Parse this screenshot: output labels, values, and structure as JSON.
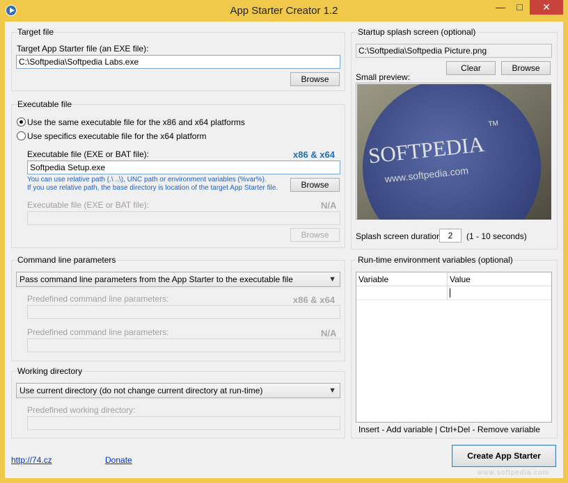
{
  "window": {
    "title": "App Starter Creator 1.2",
    "min_icon": "minimize-icon",
    "max_icon": "maximize-icon",
    "close_icon": "close-icon"
  },
  "target": {
    "group": "Target file",
    "label": "Target App Starter file (an EXE file):",
    "value": "C:\\Softpedia\\Softpedia Labs.exe",
    "browse": "Browse"
  },
  "executable": {
    "group": "Executable file",
    "radio_same": "Use the same executable file for the x86 and x64 platforms",
    "radio_specific": "Use specifics executable file for the x64 platform",
    "exe_label": "Executable file (EXE or BAT file):",
    "exe_tag": "x86 & x64",
    "exe_value": "Softpedia Setup.exe",
    "hint1": "You can use relative path (.\\ ..\\), UNC path or environment variables (%var%).",
    "hint2": "If you use relative path, the base directory is location of the target App Starter file.",
    "browse": "Browse",
    "exe2_label": "Executable file (EXE or BAT file):",
    "exe2_tag": "N/A",
    "browse2": "Browse"
  },
  "cmdline": {
    "group": "Command line parameters",
    "selected": "Pass command line parameters from the App Starter to the executable file",
    "param1_label": "Predefined command line parameters:",
    "param1_tag": "x86 & x64",
    "param2_label": "Predefined command line parameters:",
    "param2_tag": "N/A"
  },
  "workdir": {
    "group": "Working directory",
    "selected": "Use current directory (do not change current directory at run-time)",
    "predef_label": "Predefined working directory:"
  },
  "splash": {
    "group": "Startup splash screen (optional)",
    "path": "C:\\Softpedia\\Softpedia Picture.png",
    "clear": "Clear",
    "browse": "Browse",
    "preview_label": "Small preview:",
    "image_text": "SOFTPEDIA",
    "image_tm": "TM",
    "image_url": "www.softpedia.com",
    "duration_label": "Splash screen duration:",
    "duration_value": "2",
    "duration_hint": "(1 - 10 seconds)"
  },
  "env": {
    "group": "Run-time environment variables (optional)",
    "col_variable": "Variable",
    "col_value": "Value",
    "footer": "Insert - Add variable | Ctrl+Del - Remove variable"
  },
  "footer": {
    "link1": "http://74.cz",
    "link2": "Donate",
    "create": "Create App Starter",
    "watermark": "www.softpedia.com"
  }
}
